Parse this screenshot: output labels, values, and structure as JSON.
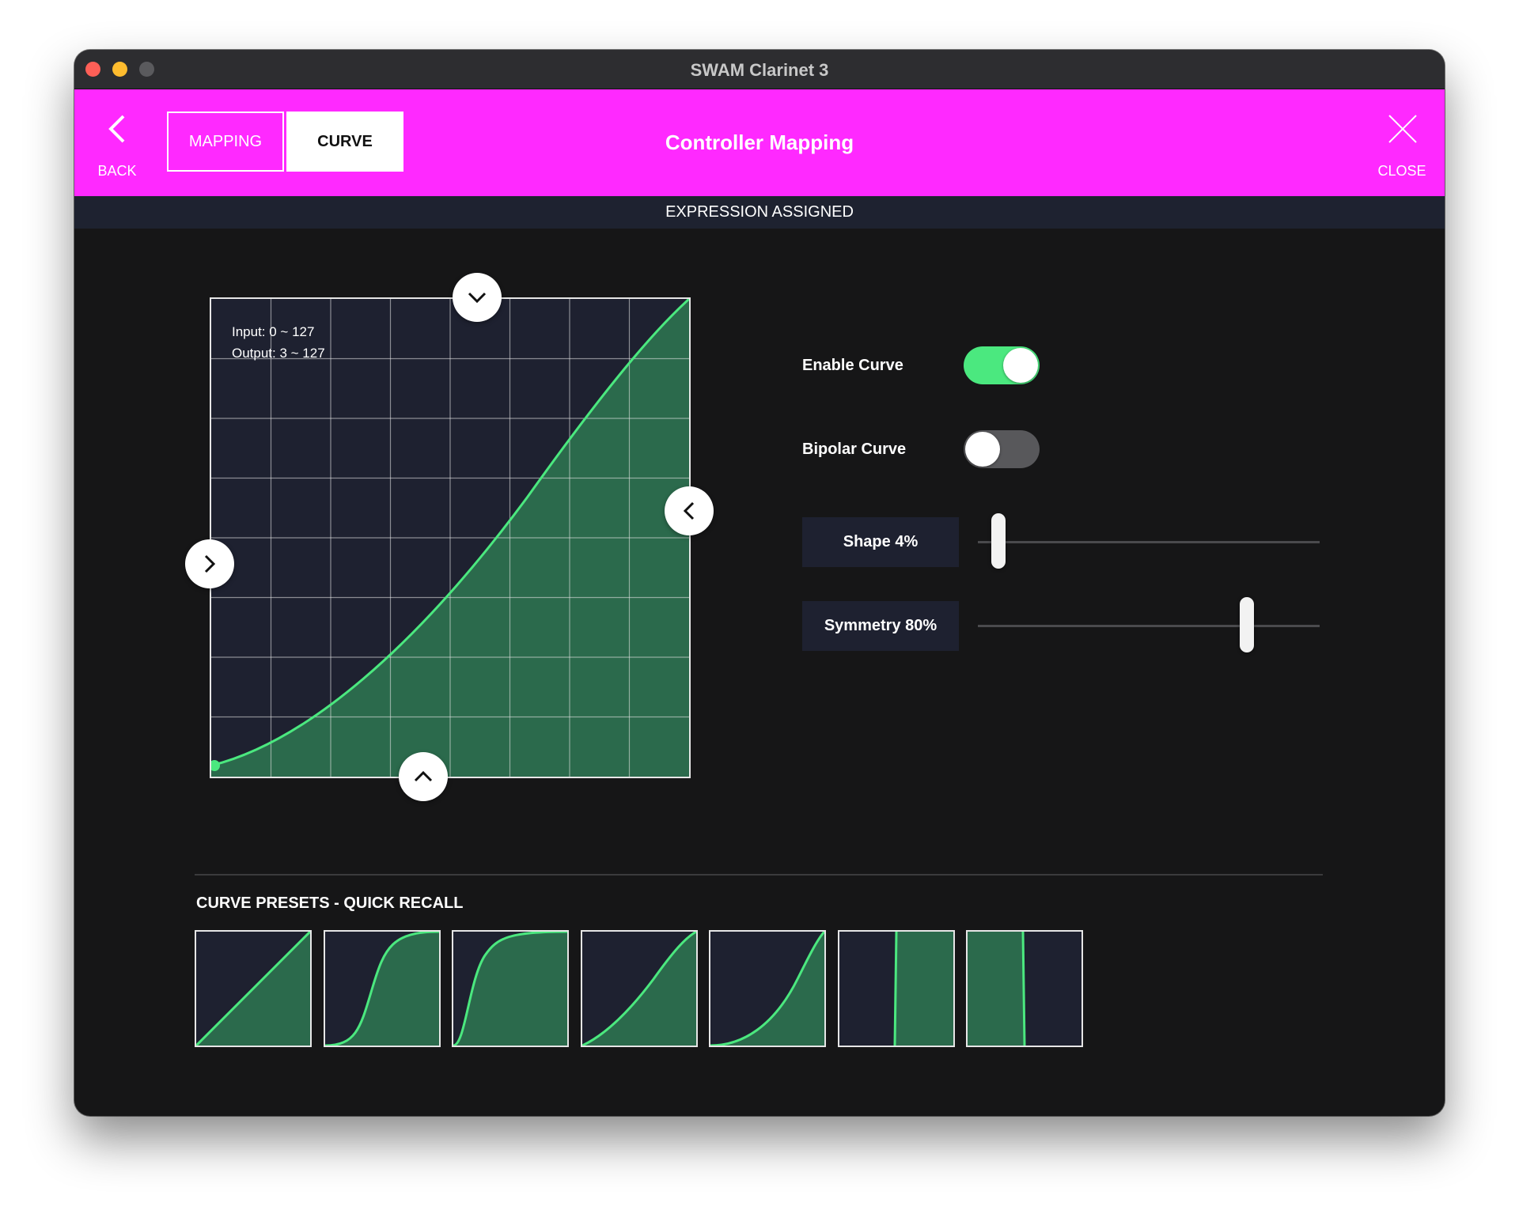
{
  "window": {
    "title": "SWAM Clarinet 3"
  },
  "header": {
    "back_label": "BACK",
    "close_label": "CLOSE",
    "title": "Controller Mapping",
    "tabs": [
      {
        "label": "MAPPING",
        "active": false
      },
      {
        "label": "CURVE",
        "active": true
      }
    ]
  },
  "status": {
    "text": "EXPRESSION ASSIGNED"
  },
  "graph": {
    "input_label": "Input: 0 ~ 127",
    "output_label": "Output: 3 ~ 127"
  },
  "controls": {
    "enable_curve": {
      "label": "Enable Curve",
      "on": true
    },
    "bipolar_curve": {
      "label": "Bipolar Curve",
      "on": false
    },
    "shape": {
      "label": "Shape 4%",
      "value": 0.04
    },
    "symmetry": {
      "label": "Symmetry 80%",
      "value": 0.8
    }
  },
  "presets": {
    "title": "CURVE PRESETS - QUICK RECALL",
    "items": [
      {
        "name": "linear"
      },
      {
        "name": "s-curve-steep"
      },
      {
        "name": "s-curve-fast"
      },
      {
        "name": "exponential-soft"
      },
      {
        "name": "exponential"
      },
      {
        "name": "step-low"
      },
      {
        "name": "step-high"
      }
    ]
  },
  "colors": {
    "accent": "#ff29ff",
    "curve": "#4be87f",
    "fill": "#2b6a4c",
    "panel": "#1e2130"
  }
}
